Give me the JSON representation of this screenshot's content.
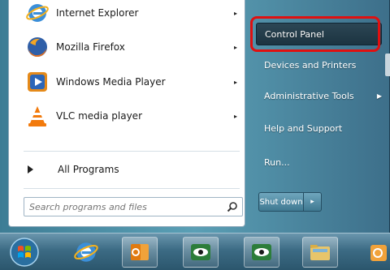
{
  "start_menu": {
    "programs": [
      {
        "label": "Internet Explorer",
        "icon": "internet-explorer-icon",
        "has_submenu": true
      },
      {
        "label": "Mozilla Firefox",
        "icon": "firefox-icon",
        "has_submenu": true
      },
      {
        "label": "Windows Media Player",
        "icon": "media-player-icon",
        "has_submenu": true
      },
      {
        "label": "VLC media player",
        "icon": "vlc-icon",
        "has_submenu": true
      }
    ],
    "all_programs": "All Programs",
    "search": {
      "placeholder": "Search programs and files"
    },
    "right_items": [
      {
        "label": "Control Panel",
        "highlighted": true
      },
      {
        "label": "Devices and Printers"
      },
      {
        "label": "Administrative Tools",
        "has_submenu": true
      },
      {
        "label": "Help and Support"
      },
      {
        "label": "Run..."
      }
    ],
    "shutdown": {
      "label": "Shut down",
      "arrow": "▸"
    }
  },
  "colors": {
    "highlight_outline": "#e01010",
    "menu_right_bg": "#4d8ca4",
    "taskbar": "#3c6b84"
  },
  "taskbar": {
    "items": [
      {
        "icon": "start-orb-icon"
      },
      {
        "icon": "internet-explorer-icon"
      },
      {
        "icon": "outlook-icon"
      },
      {
        "icon": "eye-app-icon"
      },
      {
        "icon": "eye-app-icon"
      },
      {
        "icon": "folder-icon"
      },
      {
        "icon": "app-icon"
      }
    ]
  }
}
